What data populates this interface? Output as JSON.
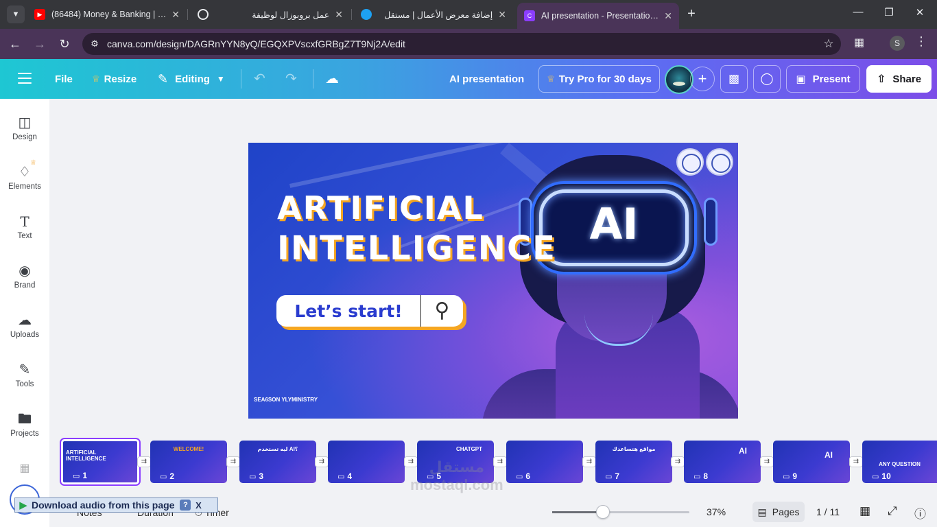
{
  "browser": {
    "tabs": [
      {
        "title": "(86484) Money & Banking | Cha",
        "favicon_color": "#ff0000"
      },
      {
        "title": "عمل بروبوزال لوظيفة",
        "favicon_color": "#35363a"
      },
      {
        "title": "إضافة معرض الأعمال | مستقل",
        "favicon_color": "#1da1f2"
      },
      {
        "title": "AI presentation - Presentation -",
        "favicon_color": "#8b3dff"
      }
    ],
    "new_tab": "+",
    "url": "canva.com/design/DAGRnYYN8yQ/EGQXPVscxfGRBgZ7T9Nj2A/edit",
    "profile_initial": "S"
  },
  "header": {
    "file": "File",
    "resize": "Resize",
    "editing": "Editing",
    "design_title": "AI presentation",
    "try_pro": "Try Pro for 30 days",
    "present": "Present",
    "share": "Share"
  },
  "sidebar": {
    "items": [
      {
        "label": "Design",
        "icon": "design-icon"
      },
      {
        "label": "Elements",
        "icon": "elements-icon"
      },
      {
        "label": "Text",
        "icon": "text-icon"
      },
      {
        "label": "Brand",
        "icon": "brand-icon"
      },
      {
        "label": "Uploads",
        "icon": "uploads-icon"
      },
      {
        "label": "Tools",
        "icon": "tools-icon"
      },
      {
        "label": "Projects",
        "icon": "projects-icon"
      }
    ]
  },
  "slide": {
    "title_line1": "ARTIFICIAL",
    "title_line2": "INTELLIGENCE",
    "start_button": "Let’s start!",
    "visor_text": "AI",
    "season_logo": "SEA6SON YLYMINISTRY",
    "colors": {
      "accent": "#f5a623",
      "background": "#3650d6",
      "button_text": "#2a3ccf"
    }
  },
  "filmstrip": {
    "thumbnails": [
      {
        "num": "1",
        "label": "ARTIFICIAL INTELLIGENCE"
      },
      {
        "num": "2",
        "label": "WELCOME!"
      },
      {
        "num": "3",
        "label": "ليه تستخدم AI؟"
      },
      {
        "num": "4",
        "label": ""
      },
      {
        "num": "5",
        "label": "CHATGPT"
      },
      {
        "num": "6",
        "label": ""
      },
      {
        "num": "7",
        "label": "مواقع هتساعدك"
      },
      {
        "num": "8",
        "label": "AI"
      },
      {
        "num": "9",
        "label": "AI"
      },
      {
        "num": "10",
        "label": "ANY QUESTION"
      }
    ]
  },
  "footer": {
    "notes": "Notes",
    "duration": "Duration",
    "timer": "Timer",
    "zoom": "37%",
    "zoom_level": 0.37,
    "pages": "Pages",
    "page_count": "1 / 11"
  },
  "overlays": {
    "download_audio": "Download audio from this page",
    "help": "?",
    "close": "X",
    "watermark_arabic": "مستقل",
    "watermark_latin": "mostaql.com"
  }
}
